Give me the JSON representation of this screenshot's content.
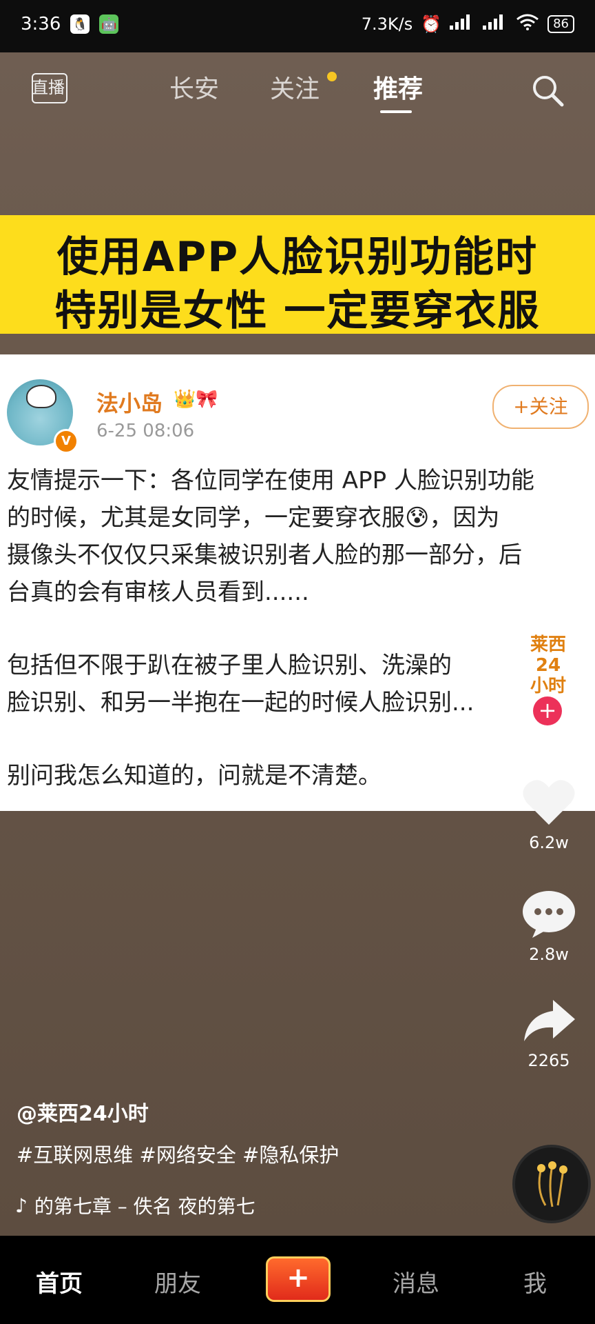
{
  "status_bar": {
    "time": "3:36",
    "network_speed": "7.3K/s",
    "battery": "86"
  },
  "top_nav": {
    "live_label": "直播",
    "tabs": [
      {
        "label": "长安"
      },
      {
        "label": "关注"
      },
      {
        "label": "推荐"
      }
    ],
    "active_tab": "推荐"
  },
  "video": {
    "banner_line1": "使用APP人脸识别功能时",
    "banner_line2": "特别是女性 一定要穿衣服",
    "post": {
      "author": "法小岛",
      "time": "6-25 08:06",
      "follow_label": "+关注",
      "para1_line1": "友情提示一下：各位同学在使用 APP 人脸识别功能",
      "para1_line2": "的时候，尤其是女同学，一定要穿衣服😰，因为",
      "para1_line3": "摄像头不仅仅只采集被识别者人脸的那一部分，后",
      "para1_line4": "台真的会有审核人员看到......",
      "para2_line1": "包括但不限于趴在被子里人脸识别、洗澡的",
      "para2_line2": "脸识别、和另一半抱在一起的时候人脸识别...",
      "para3_line1": "别问我怎么知道的，问就是不清楚。"
    },
    "creator_badge": {
      "line1": "莱西",
      "line2": "24",
      "line3": "小时"
    }
  },
  "actions": {
    "likes": "6.2w",
    "comments": "2.8w",
    "shares": "2265"
  },
  "caption": {
    "author": "@莱西24小时",
    "tags": "#互联网思维 #网络安全 #隐私保护",
    "music": "的第七章 – 佚名     夜的第七"
  },
  "bottom_nav": {
    "tabs": [
      "首页",
      "朋友",
      "消息",
      "我"
    ],
    "create_label": "+"
  }
}
